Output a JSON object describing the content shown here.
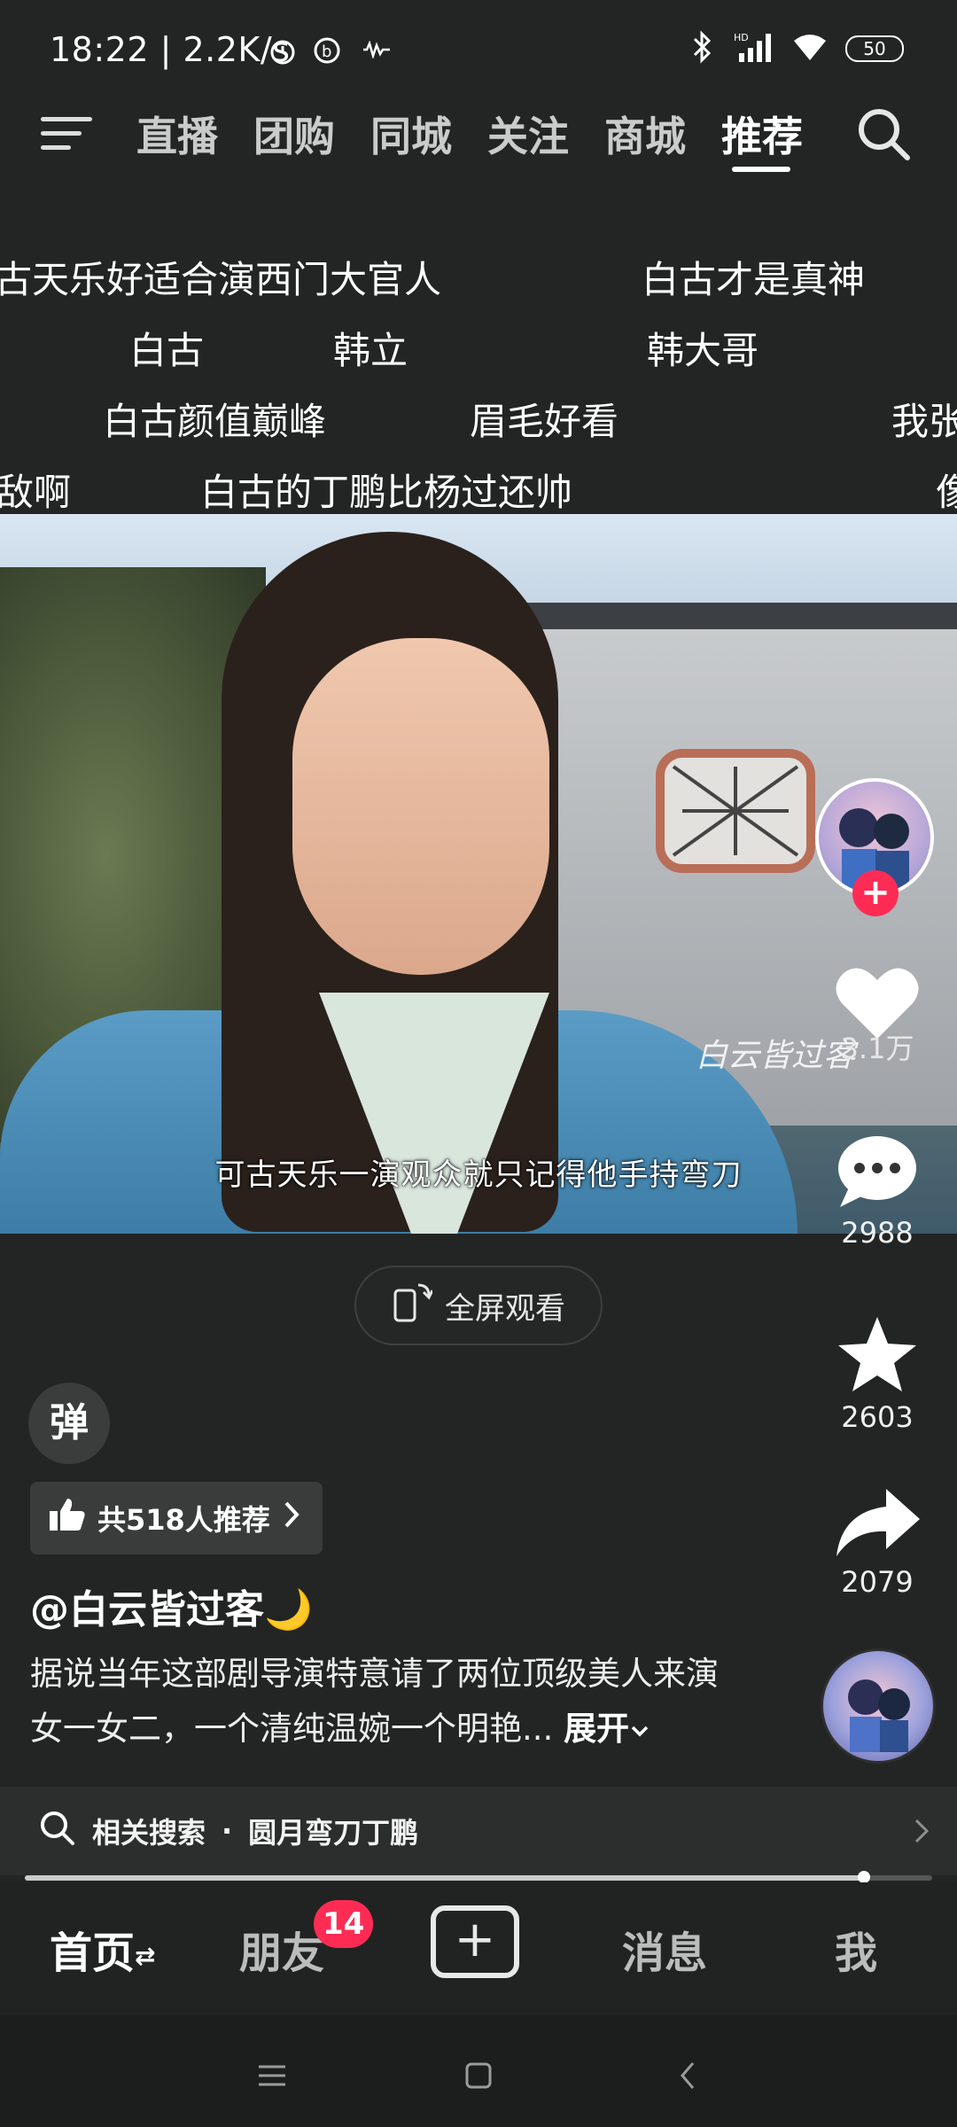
{
  "status_bar": {
    "time": "18:22 | 2.2K/s",
    "battery": "50"
  },
  "top_nav": {
    "tabs": [
      "直播",
      "团购",
      "同城",
      "关注",
      "商城",
      "推荐"
    ],
    "active_tab": "推荐"
  },
  "danmaku": {
    "row1": [
      "古天乐好适合演西门大官人",
      "白古才是真神"
    ],
    "row2": [
      "白古",
      "韩立",
      "韩大哥"
    ],
    "row3": [
      "白古颜值巅峰",
      "眉毛好看",
      "我张"
    ],
    "row4": [
      "敌啊",
      "白古的丁鹏比杨过还帅",
      "像"
    ]
  },
  "video": {
    "subtitle": "可古天乐一演观众就只记得他手持弯刀",
    "watermark": "白云皆过客"
  },
  "fullscreen_label": "全屏观看",
  "actions": {
    "like_count": "3.1万",
    "comment_count": "2988",
    "favorite_count": "2603",
    "share_count": "2079"
  },
  "danmu_toggle": "弹",
  "recommend": "共518人推荐",
  "author": "@白云皆过客🌙",
  "description": {
    "line1": "据说当年这部剧导演特意请了两位顶级美人来演",
    "line2": "女一女二，一个清纯温婉一个明艳...",
    "more": "展开"
  },
  "related_search": {
    "prefix": "相关搜索",
    "sep": "·",
    "query": "圆月弯刀丁鹏"
  },
  "playback_progress": 0.925,
  "bottom_nav": {
    "home": "首页",
    "friends": "朋友",
    "friends_badge": "14",
    "messages": "消息",
    "me": "我"
  },
  "colors": {
    "accent": "#fe2c55",
    "background": "#222523"
  }
}
